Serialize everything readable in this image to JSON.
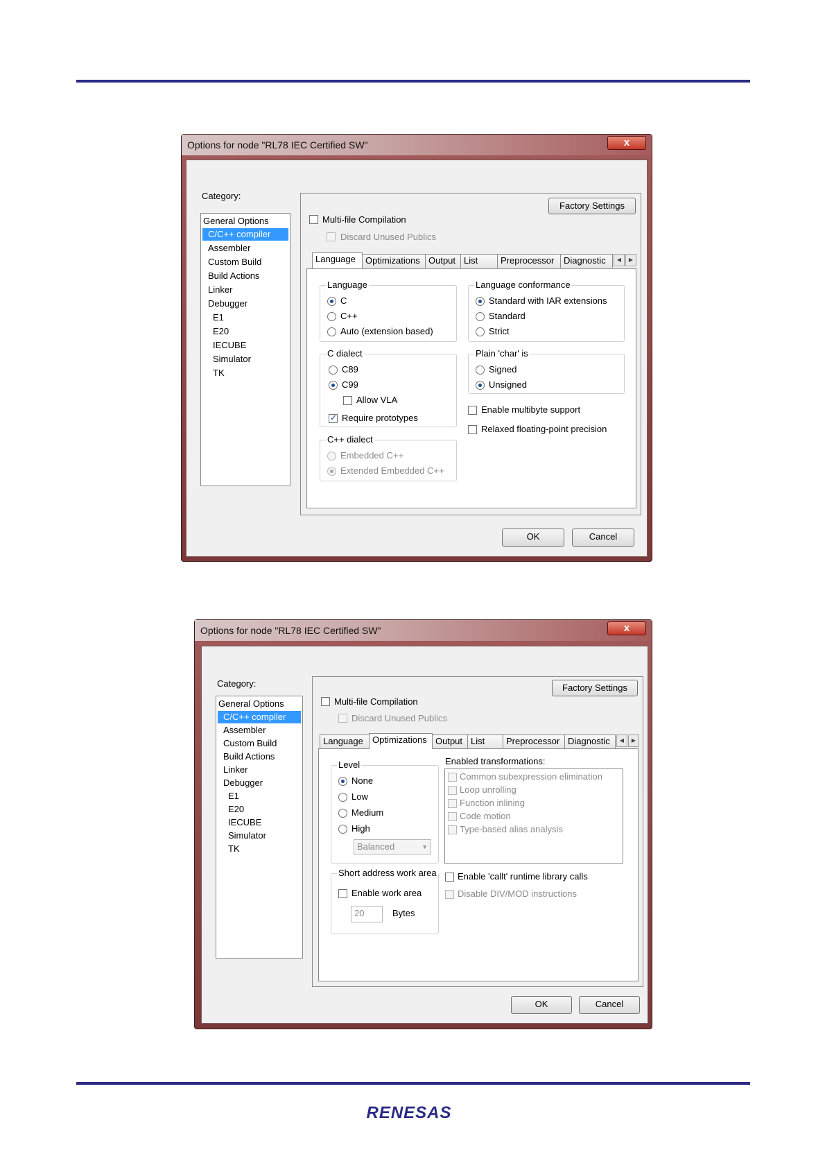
{
  "dialog1": {
    "title": "Options for node \"RL78 IEC Certified SW\"",
    "close_label": "x",
    "category_label": "Category:",
    "categories": [
      "General Options",
      "C/C++ compiler",
      "Assembler",
      "Custom Build",
      "Build Actions",
      "Linker",
      "Debugger",
      "E1",
      "E20",
      "IECUBE",
      "Simulator",
      "TK"
    ],
    "factory_settings": "Factory Settings",
    "multifile": "Multi-file Compilation",
    "discard": "Discard Unused Publics",
    "tabs": [
      "Language",
      "Optimizations",
      "Output",
      "List",
      "Preprocessor",
      "Diagnostic"
    ],
    "language_group": {
      "title": "Language",
      "options": [
        "C",
        "C++",
        "Auto (extension based)"
      ]
    },
    "conformance_group": {
      "title": "Language conformance",
      "options": [
        "Standard with IAR extensions",
        "Standard",
        "Strict"
      ]
    },
    "cdialect_group": {
      "title": "C dialect",
      "options": [
        "C89",
        "C99"
      ],
      "allow_vla": "Allow VLA",
      "require_proto": "Require prototypes"
    },
    "char_group": {
      "title": "Plain 'char' is",
      "options": [
        "Signed",
        "Unsigned"
      ]
    },
    "multibyte": "Enable multibyte support",
    "relaxed_fp": "Relaxed floating-point precision",
    "cppdialect_group": {
      "title": "C++ dialect",
      "options": [
        "Embedded C++",
        "Extended Embedded C++"
      ]
    },
    "ok": "OK",
    "cancel": "Cancel"
  },
  "dialog2": {
    "title": "Options for node \"RL78 IEC Certified SW\"",
    "close_label": "x",
    "category_label": "Category:",
    "categories": [
      "General Options",
      "C/C++ compiler",
      "Assembler",
      "Custom Build",
      "Build Actions",
      "Linker",
      "Debugger",
      "E1",
      "E20",
      "IECUBE",
      "Simulator",
      "TK"
    ],
    "factory_settings": "Factory Settings",
    "multifile": "Multi-file Compilation",
    "discard": "Discard Unused Publics",
    "tabs": [
      "Language",
      "Optimizations",
      "Output",
      "List",
      "Preprocessor",
      "Diagnostic"
    ],
    "level_group": {
      "title": "Level",
      "options": [
        "None",
        "Low",
        "Medium",
        "High"
      ],
      "combo_value": "Balanced"
    },
    "transform_label": "Enabled transformations:",
    "transforms": [
      "Common subexpression elimination",
      "Loop unrolling",
      "Function inlining",
      "Code motion",
      "Type-based alias analysis"
    ],
    "short_group": {
      "title": "Short address work area",
      "enable": "Enable work area",
      "value": "20",
      "unit": "Bytes"
    },
    "callt": "Enable 'callt' runtime library calls",
    "divmod": "Disable DIV/MOD instructions",
    "ok": "OK",
    "cancel": "Cancel"
  },
  "footer": {
    "logo_text": "RENESAS",
    "brand_color": "#2b2b86"
  }
}
